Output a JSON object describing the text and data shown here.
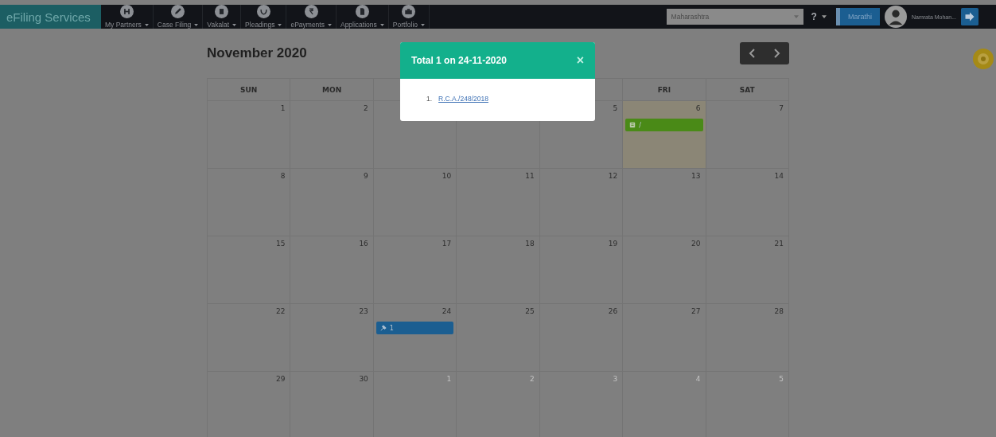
{
  "navbar": {
    "brand": "eFiling Services",
    "menus": [
      {
        "label": "My Partners"
      },
      {
        "label": "Case Filing"
      },
      {
        "label": "Vakalat"
      },
      {
        "label": "Pleadings"
      },
      {
        "label": "ePayments"
      },
      {
        "label": "Applications"
      },
      {
        "label": "Portfolio"
      }
    ],
    "state_select": {
      "value": "Maharashtra"
    },
    "help": "?",
    "language_button": "Marathi",
    "user_name": "Namrata Mohan..."
  },
  "calendar": {
    "title": "November 2020",
    "columns": [
      {
        "label": "SUN"
      },
      {
        "label": "MON"
      },
      {},
      {},
      {},
      {
        "label": "FRI"
      },
      {
        "label": "SAT"
      }
    ],
    "weeks": [
      [
        {
          "day": "1",
          "other_month": false,
          "today": false
        },
        {
          "day": "2",
          "other_month": false,
          "today": false
        },
        {
          "today": false
        },
        {
          "today": false
        },
        {
          "day": "5",
          "other_month": false,
          "today": false
        },
        {
          "day": "6",
          "other_month": false,
          "today": true,
          "events": [
            {
              "kind": "document",
              "text": "/",
              "color": "#4a8a17"
            }
          ]
        },
        {
          "day": "7",
          "other_month": false,
          "today": false
        }
      ],
      [
        {
          "day": "8",
          "other_month": false,
          "today": false
        },
        {
          "day": "9",
          "other_month": false,
          "today": false
        },
        {
          "day": "10",
          "other_month": false,
          "today": false
        },
        {
          "day": "11",
          "other_month": false,
          "today": false
        },
        {
          "day": "12",
          "other_month": false,
          "today": false
        },
        {
          "day": "13",
          "other_month": false,
          "today": false
        },
        {
          "day": "14",
          "other_month": false,
          "today": false
        }
      ],
      [
        {
          "day": "15",
          "other_month": false,
          "today": false
        },
        {
          "day": "16",
          "other_month": false,
          "today": false
        },
        {
          "day": "17",
          "other_month": false,
          "today": false
        },
        {
          "day": "18",
          "other_month": false,
          "today": false
        },
        {
          "day": "19",
          "other_month": false,
          "today": false
        },
        {
          "day": "20",
          "other_month": false,
          "today": false
        },
        {
          "day": "21",
          "other_month": false,
          "today": false
        }
      ],
      [
        {
          "day": "22",
          "other_month": false,
          "today": false
        },
        {
          "day": "23",
          "other_month": false,
          "today": false
        },
        {
          "day": "24",
          "other_month": false,
          "today": false,
          "events": [
            {
              "kind": "hearing",
              "text": "1",
              "color": "#1b5e91"
            }
          ]
        },
        {
          "day": "25",
          "other_month": false,
          "today": false
        },
        {
          "day": "26",
          "other_month": false,
          "today": false
        },
        {
          "day": "27",
          "other_month": false,
          "today": false
        },
        {
          "day": "28",
          "other_month": false,
          "today": false
        }
      ],
      [
        {
          "day": "29",
          "other_month": false,
          "today": false
        },
        {
          "day": "30",
          "other_month": false,
          "today": false
        },
        {
          "day": "1",
          "other_month": true,
          "today": false
        },
        {
          "day": "2",
          "other_month": true,
          "today": false
        },
        {
          "day": "3",
          "other_month": true,
          "today": false
        },
        {
          "day": "4",
          "other_month": true,
          "today": false
        },
        {
          "day": "5",
          "other_month": true,
          "today": false
        }
      ]
    ]
  },
  "popup": {
    "title": "Total 1 on 24-11-2020",
    "close": "×",
    "items": [
      {
        "number": "1.",
        "link": "R.C.A./248/2018"
      }
    ]
  }
}
